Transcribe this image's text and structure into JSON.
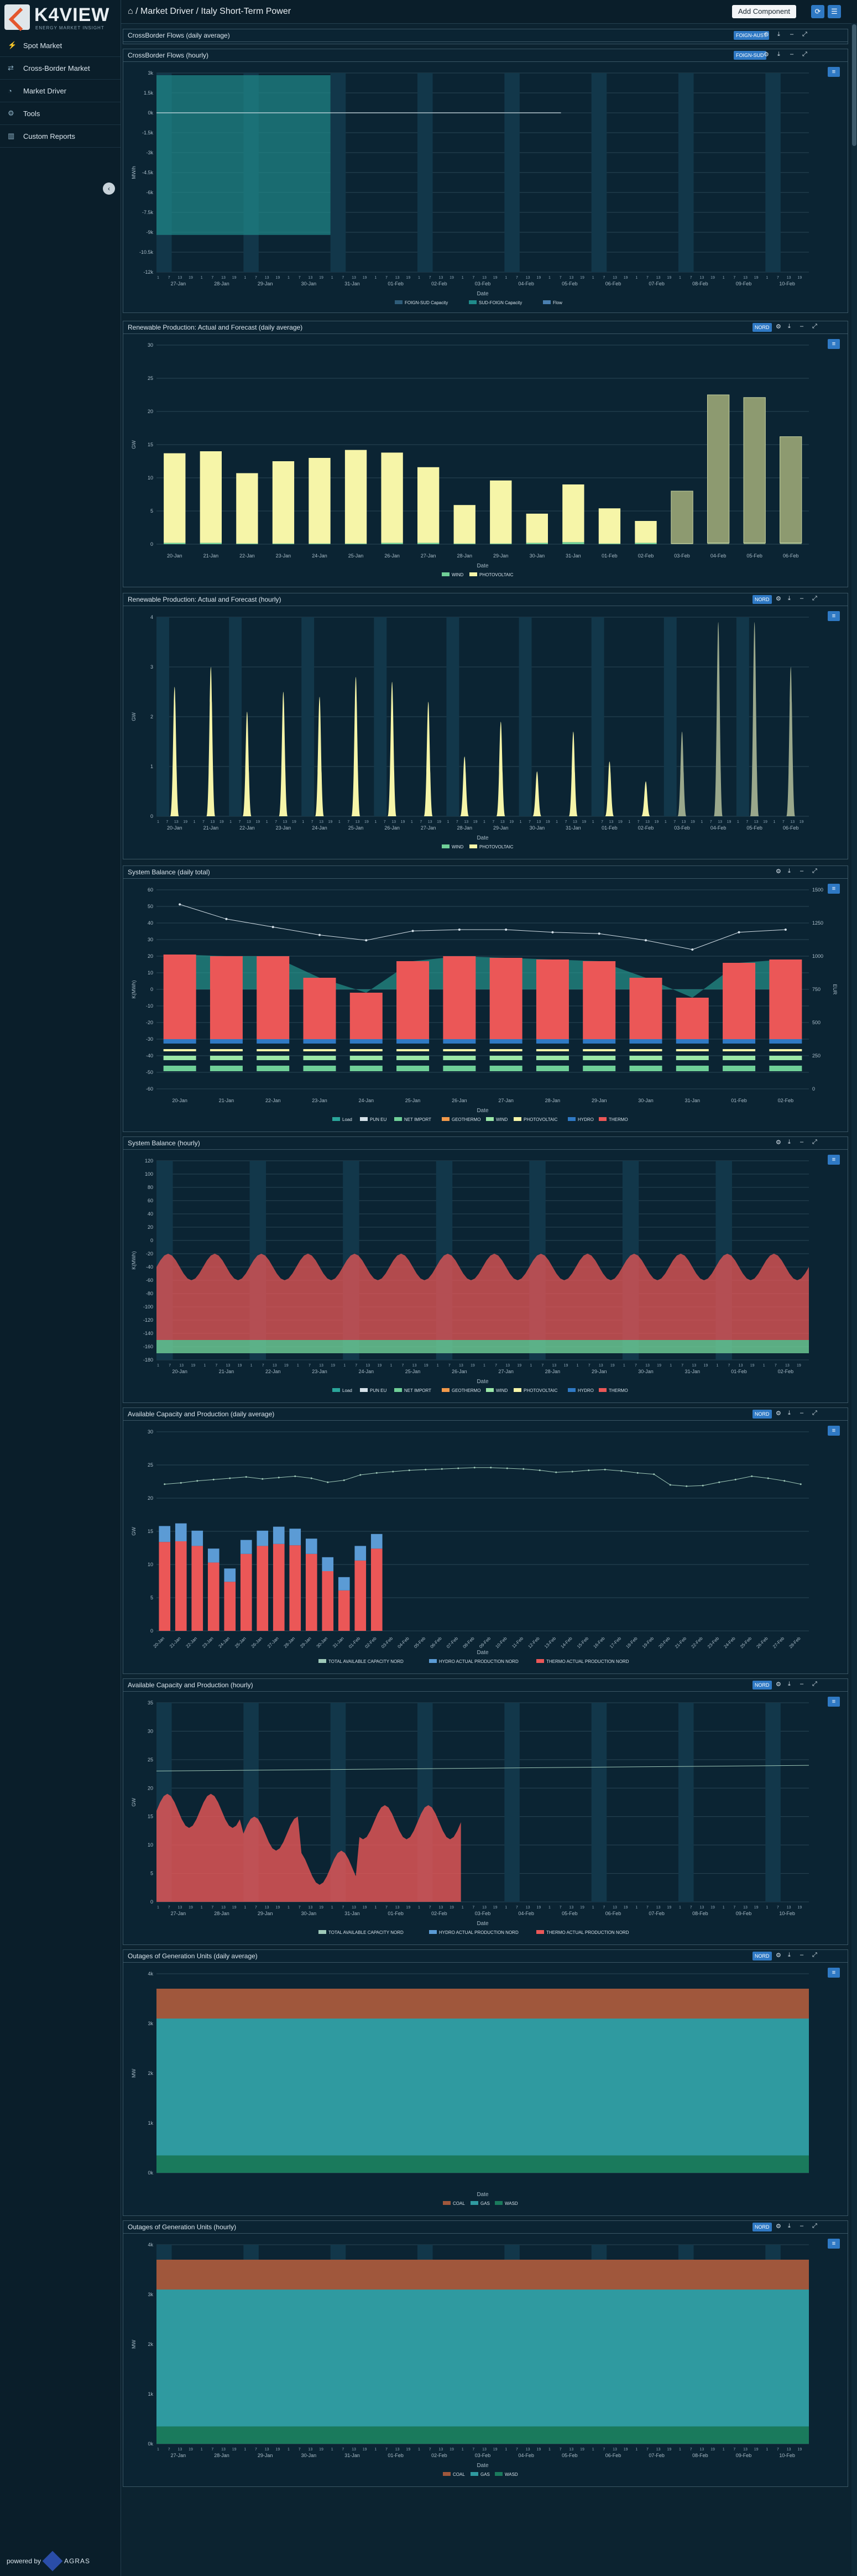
{
  "app": {
    "brand": "K4VIEW",
    "tagline": "ENERGY MARKET INSIGHT",
    "powered_by": "powered by",
    "powered_brand": "AGRAS"
  },
  "nav": [
    {
      "label": "Spot Market",
      "icon": "bolt-icon"
    },
    {
      "label": "Cross-Border Market",
      "icon": "share-icon"
    },
    {
      "label": "Market Driver",
      "icon": "gauge-icon"
    },
    {
      "label": "Tools",
      "icon": "gear-icon"
    },
    {
      "label": "Custom Reports",
      "icon": "bar-chart-icon"
    }
  ],
  "header": {
    "breadcrumb": "Market Driver / Italy Short-Term Power",
    "add_component": "Add Component"
  },
  "panels": [
    {
      "title": "CrossBorder Flows (daily average)",
      "selector": "FOIGN-AUST",
      "collapsed": true
    },
    {
      "title": "CrossBorder Flows (hourly)",
      "selector": "FOIGN-SUD",
      "chart_data": {
        "type": "line",
        "ylabel": "MW/h",
        "xlabel": "Date",
        "y_ticks": [
          "3k",
          "1.5k",
          "0k",
          "-1.5k",
          "-3k",
          "-4.5k",
          "-6k",
          "-7.5k",
          "-9k",
          "-10.5k",
          "-12k"
        ],
        "dates": [
          "27-Jan",
          "28-Jan",
          "29-Jan",
          "30-Jan",
          "31-Jan",
          "01-Feb",
          "02-Feb",
          "03-Feb",
          "04-Feb",
          "05-Feb",
          "06-Feb",
          "07-Feb",
          "08-Feb",
          "09-Feb",
          "10-Feb"
        ],
        "series": [
          {
            "name": "FOIGN-SUD Capacity",
            "color": "#2f5d7a"
          },
          {
            "name": "SUD-FOIGN Capacity",
            "color": "#1f8a8a"
          },
          {
            "name": "Flow",
            "color": "#4a7fb0"
          }
        ]
      }
    },
    {
      "title": "Renewable Production: Actual and Forecast (daily average)",
      "selector": "NORD",
      "chart_data": {
        "type": "bar",
        "ylabel": "GW",
        "xlabel": "Date",
        "ylim": [
          0,
          30
        ],
        "categories": [
          "20-Jan",
          "21-Jan",
          "22-Jan",
          "23-Jan",
          "24-Jan",
          "25-Jan",
          "26-Jan",
          "27-Jan",
          "28-Jan",
          "29-Jan",
          "30-Jan",
          "31-Jan",
          "01-Feb",
          "02-Feb",
          "03-Feb",
          "04-Feb",
          "05-Feb",
          "06-Feb"
        ],
        "series": [
          {
            "name": "WIND",
            "color": "#6fcf97",
            "values": [
              0.2,
              0.2,
              0.1,
              0.1,
              0.1,
              0.1,
              0.2,
              0.2,
              0.1,
              0.1,
              0.2,
              0.3,
              0.1,
              0.2,
              0.1,
              0.2,
              0.2,
              0.2
            ]
          },
          {
            "name": "PHOTOVOLTAIC",
            "color": "#f6f5a8",
            "values": [
              13.5,
              13.8,
              10.6,
              12.4,
              12.9,
              14.1,
              13.6,
              11.4,
              5.8,
              9.5,
              4.4,
              8.7,
              5.3,
              3.3,
              7.9,
              22.3,
              21.9,
              16.0
            ]
          }
        ],
        "forecast_from": "03-Feb"
      }
    },
    {
      "title": "Renewable Production: Actual and Forecast (hourly)",
      "selector": "NORD",
      "chart_data": {
        "type": "area",
        "ylabel": "GW",
        "xlabel": "Date",
        "ylim": [
          0,
          4
        ],
        "categories": [
          "20-Jan",
          "21-Jan",
          "22-Jan",
          "23-Jan",
          "24-Jan",
          "25-Jan",
          "26-Jan",
          "27-Jan",
          "28-Jan",
          "29-Jan",
          "30-Jan",
          "31-Jan",
          "01-Feb",
          "02-Feb",
          "03-Feb",
          "04-Feb",
          "05-Feb",
          "06-Feb"
        ],
        "daily_peak": [
          2.6,
          3.0,
          2.1,
          2.5,
          2.4,
          2.8,
          2.7,
          2.3,
          1.2,
          1.9,
          0.9,
          1.7,
          1.1,
          0.7,
          1.7,
          3.9,
          3.9,
          3.0
        ],
        "series": [
          {
            "name": "WIND",
            "color": "#6fcf97"
          },
          {
            "name": "PHOTOVOLTAIC",
            "color": "#f6f5a8"
          }
        ],
        "forecast_from": "03-Feb"
      }
    },
    {
      "title": "System Balance (daily total)",
      "chart_data": {
        "type": "bar",
        "ylabel": "K(MWh)",
        "ylabel_right": "EUR",
        "xlabel": "Date",
        "ylim": [
          -60,
          60
        ],
        "ylim_right": [
          0,
          1500
        ],
        "categories": [
          "20-Jan",
          "21-Jan",
          "22-Jan",
          "23-Jan",
          "24-Jan",
          "25-Jan",
          "26-Jan",
          "27-Jan",
          "28-Jan",
          "29-Jan",
          "30-Jan",
          "31-Jan",
          "01-Feb",
          "02-Feb"
        ],
        "load": [
          21,
          20,
          20,
          7,
          -2,
          17,
          20,
          19,
          18,
          17,
          7,
          -5,
          16,
          18
        ],
        "pun": [
          1390,
          1280,
          1220,
          1160,
          1120,
          1190,
          1200,
          1200,
          1180,
          1170,
          1120,
          1050,
          1180,
          1200
        ],
        "series": [
          {
            "name": "Load",
            "color": "#2aa59a"
          },
          {
            "name": "PUN EU",
            "color": "#d6e2ea"
          },
          {
            "name": "NET IMPORT",
            "color": "#6fcf97"
          },
          {
            "name": "GEOTHERMO",
            "color": "#f2994a"
          },
          {
            "name": "WIND",
            "color": "#9be7a8"
          },
          {
            "name": "PHOTOVOLTAIC",
            "color": "#f6f5a8"
          },
          {
            "name": "HYDRO",
            "color": "#2f79c4"
          },
          {
            "name": "THERMO",
            "color": "#eb5757"
          }
        ]
      }
    },
    {
      "title": "System Balance (hourly)",
      "chart_data": {
        "type": "area",
        "ylabel": "K(MWh)",
        "ylabel_right": "EUR",
        "xlabel": "Date",
        "ylim": [
          -180,
          120
        ],
        "categories": [
          "20-Jan",
          "21-Jan",
          "22-Jan",
          "23-Jan",
          "24-Jan",
          "25-Jan",
          "26-Jan",
          "27-Jan",
          "28-Jan",
          "29-Jan",
          "30-Jan",
          "31-Jan",
          "01-Feb",
          "02-Feb"
        ],
        "series": [
          {
            "name": "Load"
          },
          {
            "name": "PUN EU"
          },
          {
            "name": "NET IMPORT"
          },
          {
            "name": "GEOTHERMO"
          },
          {
            "name": "WIND"
          },
          {
            "name": "PHOTOVOLTAIC"
          },
          {
            "name": "HYDRO"
          },
          {
            "name": "THERMO"
          }
        ]
      }
    },
    {
      "title": "Available Capacity and Production (daily average)",
      "selector": "NORD",
      "chart_data": {
        "type": "bar",
        "ylabel": "GW",
        "xlabel": "Date",
        "ylim": [
          0,
          30
        ],
        "categories": [
          "20-Jan",
          "21-Jan",
          "22-Jan",
          "23-Jan",
          "24-Jan",
          "25-Jan",
          "26-Jan",
          "27-Jan",
          "28-Jan",
          "29-Jan",
          "30-Jan",
          "31-Jan",
          "01-Feb",
          "02-Feb",
          "03-Feb",
          "04-Feb",
          "05-Feb",
          "06-Feb",
          "07-Feb",
          "08-Feb",
          "09-Feb",
          "10-Feb",
          "11-Feb",
          "12-Feb",
          "13-Feb",
          "14-Feb",
          "15-Feb",
          "16-Feb",
          "17-Feb",
          "18-Feb",
          "19-Feb",
          "20-Feb",
          "21-Feb",
          "22-Feb",
          "23-Feb",
          "24-Feb",
          "25-Feb",
          "26-Feb",
          "27-Feb",
          "28-Feb"
        ],
        "capacity": [
          22.1,
          22.3,
          22.6,
          22.8,
          23.0,
          23.2,
          22.9,
          23.1,
          23.3,
          23.0,
          22.4,
          22.7,
          23.5,
          23.8,
          24.0,
          24.2,
          24.3,
          24.4,
          24.5,
          24.6,
          24.6,
          24.5,
          24.4,
          24.2,
          23.9,
          24.0,
          24.2,
          24.3,
          24.1,
          23.8,
          23.6,
          22.0,
          21.8,
          21.9,
          22.4,
          22.8,
          23.3,
          23.0,
          22.6,
          22.1
        ],
        "series": [
          {
            "name": "TOTAL AVAILABLE CAPACITY NORD",
            "color": "#9fc9b8"
          },
          {
            "name": "HYDRO ACTUAL PRODUCTION NORD",
            "color": "#5b9bd5",
            "values": [
              2.4,
              2.7,
              2.3,
              2.1,
              2.0,
              2.1,
              2.3,
              2.6,
              2.5,
              2.3,
              2.1,
              2.0,
              2.2,
              2.2
            ]
          },
          {
            "name": "THERMO ACTUAL PRODUCTION NORD",
            "color": "#eb5757",
            "values": [
              13.4,
              13.5,
              12.8,
              10.3,
              7.4,
              11.6,
              12.8,
              13.1,
              12.9,
              11.6,
              9.0,
              6.1,
              10.6,
              12.4
            ]
          }
        ]
      }
    },
    {
      "title": "Available Capacity and Production (hourly)",
      "selector": "NORD",
      "chart_data": {
        "type": "area",
        "ylabel": "GW",
        "xlabel": "Date",
        "ylim": [
          0,
          35
        ],
        "categories": [
          "27-Jan",
          "28-Jan",
          "29-Jan",
          "30-Jan",
          "31-Jan",
          "01-Feb",
          "02-Feb",
          "03-Feb",
          "04-Feb",
          "05-Feb",
          "06-Feb",
          "07-Feb",
          "08-Feb",
          "09-Feb",
          "10-Feb"
        ],
        "series": [
          {
            "name": "TOTAL AVAILABLE CAPACITY NORD"
          },
          {
            "name": "HYDRO ACTUAL PRODUCTION NORD"
          },
          {
            "name": "THERMO ACTUAL PRODUCTION NORD"
          }
        ]
      }
    },
    {
      "title": "Outages of Generation Units (daily average)",
      "selector": "NORD",
      "chart_data": {
        "type": "area",
        "ylabel": "MW",
        "xlabel": "Date",
        "y_ticks": [
          "4k",
          "3k",
          "2k",
          "1k",
          "0k"
        ],
        "series": [
          {
            "name": "COAL",
            "color": "#a0573c"
          },
          {
            "name": "GAS",
            "color": "#2f9aa0"
          },
          {
            "name": "WASD",
            "color": "#1a7a5c"
          }
        ]
      }
    },
    {
      "title": "Outages of Generation Units (hourly)",
      "selector": "NORD",
      "chart_data": {
        "type": "area",
        "ylabel": "MW",
        "xlabel": "Date",
        "y_ticks": [
          "4k",
          "3k",
          "2k",
          "1k",
          "0k"
        ],
        "categories": [
          "27-Jan",
          "28-Jan",
          "29-Jan",
          "30-Jan",
          "31-Jan",
          "01-Feb",
          "02-Feb",
          "03-Feb",
          "04-Feb",
          "05-Feb",
          "06-Feb",
          "07-Feb",
          "08-Feb",
          "09-Feb",
          "10-Feb"
        ],
        "series": [
          {
            "name": "COAL",
            "color": "#a0573c"
          },
          {
            "name": "GAS",
            "color": "#2f9aa0"
          },
          {
            "name": "WASD",
            "color": "#1a7a5c"
          }
        ]
      }
    }
  ]
}
